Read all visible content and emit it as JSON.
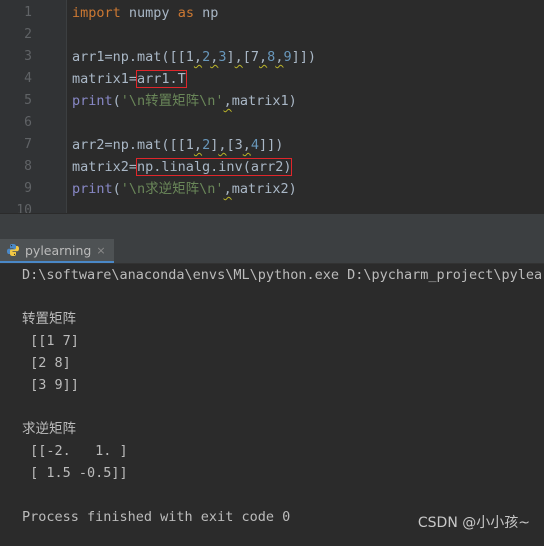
{
  "editor": {
    "line_numbers": [
      "1",
      "2",
      "3",
      "4",
      "5",
      "6",
      "7",
      "8",
      "9",
      "10"
    ],
    "lines": [
      {
        "parts": [
          [
            "kw",
            "import"
          ],
          [
            "plain",
            " numpy "
          ],
          [
            "kw",
            "as"
          ],
          [
            "plain",
            " np"
          ]
        ]
      },
      {
        "parts": []
      },
      {
        "parts": [
          [
            "plain",
            "arr1=np.mat([[1"
          ],
          [
            "plain",
            ","
          ],
          [
            "num",
            "2"
          ],
          [
            "plain",
            ","
          ],
          [
            "num",
            "3"
          ],
          [
            "plain",
            "]"
          ],
          [
            "plain",
            ","
          ],
          [
            "plain",
            "[7"
          ],
          [
            "plain",
            ","
          ],
          [
            "num",
            "8"
          ],
          [
            "plain",
            ","
          ],
          [
            "num",
            "9"
          ],
          [
            "plain",
            "]])"
          ]
        ]
      },
      {
        "parts": [
          [
            "plain",
            "matrix1="
          ],
          [
            "box",
            "arr1.T"
          ]
        ]
      },
      {
        "parts": [
          [
            "fn",
            "print"
          ],
          [
            "plain",
            "("
          ],
          [
            "str",
            "'\\n转置矩阵\\n'"
          ],
          [
            "plain",
            ","
          ],
          [
            "plain",
            "matrix1)"
          ]
        ]
      },
      {
        "parts": []
      },
      {
        "parts": [
          [
            "plain",
            "arr2=np.mat([[1"
          ],
          [
            "plain",
            ","
          ],
          [
            "num",
            "2"
          ],
          [
            "plain",
            "]"
          ],
          [
            "plain",
            ","
          ],
          [
            "plain",
            "[3"
          ],
          [
            "plain",
            ","
          ],
          [
            "num",
            "4"
          ],
          [
            "plain",
            "]])"
          ]
        ]
      },
      {
        "parts": [
          [
            "plain",
            "matrix2="
          ],
          [
            "box",
            "np.linalg.inv(arr2)"
          ]
        ]
      },
      {
        "parts": [
          [
            "fn",
            "print"
          ],
          [
            "plain",
            "("
          ],
          [
            "str",
            "'\\n求逆矩阵\\n'"
          ],
          [
            "plain",
            ","
          ],
          [
            "plain",
            "matrix2)"
          ]
        ]
      },
      {
        "parts": []
      }
    ]
  },
  "run_panel": {
    "tab_label": "pylearning",
    "close_glyph": "×",
    "icon": "python-icon"
  },
  "console": {
    "lines": [
      "D:\\software\\anaconda\\envs\\ML\\python.exe D:\\pycharm_project\\pylearn",
      "",
      "转置矩阵",
      " [[1 7]",
      " [2 8]",
      " [3 9]]",
      "",
      "求逆矩阵",
      " [[-2.   1. ]",
      " [ 1.5 -0.5]]",
      "",
      "Process finished with exit code 0"
    ]
  },
  "watermark": "CSDN @小小孩~",
  "colors": {
    "editor_bg": "#2b2b2b",
    "gutter_bg": "#313335",
    "keyword": "#cc7832",
    "number": "#6897bb",
    "string": "#6a8759",
    "builtin": "#8888c6",
    "highlight_box": "#e0262b"
  }
}
